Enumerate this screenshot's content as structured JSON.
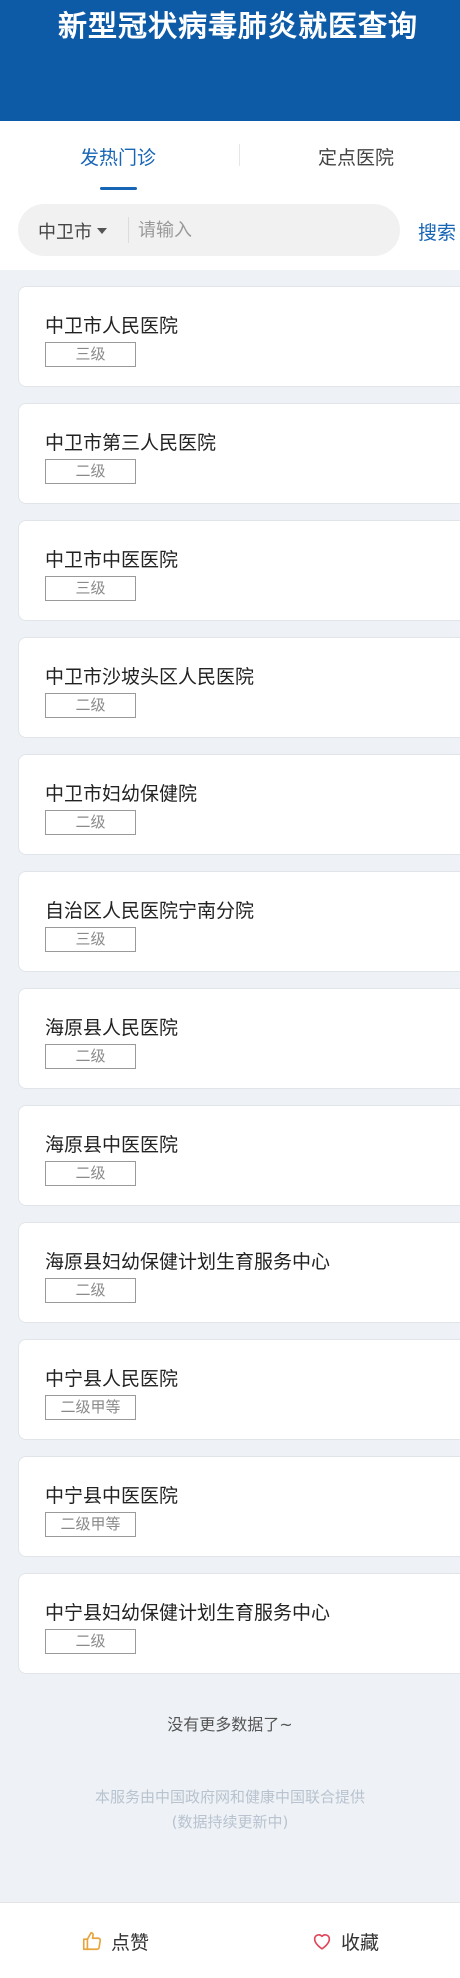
{
  "header": {
    "title": "新型冠状病毒肺炎就医查询"
  },
  "tabs": [
    {
      "label": "发热门诊",
      "active": true
    },
    {
      "label": "定点医院",
      "active": false
    }
  ],
  "search": {
    "city": "中卫市",
    "placeholder": "请输入",
    "value": "",
    "button_label": "搜索"
  },
  "hospitals": [
    {
      "name": "中卫市人民医院",
      "level": "三级"
    },
    {
      "name": "中卫市第三人民医院",
      "level": "二级"
    },
    {
      "name": "中卫市中医医院",
      "level": "三级"
    },
    {
      "name": "中卫市沙坡头区人民医院",
      "level": "二级"
    },
    {
      "name": "中卫市妇幼保健院",
      "level": "二级"
    },
    {
      "name": "自治区人民医院宁南分院",
      "level": "三级"
    },
    {
      "name": "海原县人民医院",
      "level": "二级"
    },
    {
      "name": "海原县中医医院",
      "level": "二级"
    },
    {
      "name": "海原县妇幼保健计划生育服务中心",
      "level": "二级"
    },
    {
      "name": "中宁县人民医院",
      "level": "二级甲等"
    },
    {
      "name": "中宁县中医医院",
      "level": "二级甲等"
    },
    {
      "name": "中宁县妇幼保健计划生育服务中心",
      "level": "二级"
    }
  ],
  "list_end_text": "没有更多数据了~",
  "footer": {
    "line1": "本服务由中国政府网和健康中国联合提供",
    "line2": "(数据持续更新中)"
  },
  "bottom_bar": {
    "like_label": "点赞",
    "like_icon": "thumbs-up-icon",
    "favorite_label": "收藏",
    "favorite_icon": "heart-icon"
  },
  "colors": {
    "header_bg": "#0d5aa7",
    "accent": "#1765b5",
    "like_icon": "#e8a33c",
    "favorite_icon": "#e0465a"
  }
}
